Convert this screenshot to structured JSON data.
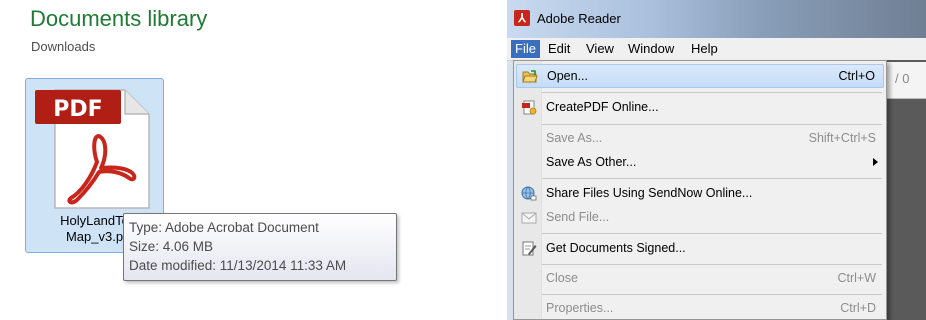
{
  "library": {
    "title": "Documents library",
    "subtitle": "Downloads",
    "file": {
      "badge": "PDF",
      "name_line1": "HolyLandTo",
      "name_line2": "Map_v3.p"
    },
    "tooltip": {
      "type": "Type: Adobe Acrobat Document",
      "size": "Size: 4.06 MB",
      "date": "Date modified: 11/13/2014 11:33 AM"
    }
  },
  "reader": {
    "title": "Adobe Reader",
    "app_icon_glyph": "⅄",
    "menubar": [
      "File",
      "Edit",
      "View",
      "Window",
      "Help"
    ],
    "page_indicator": "/ 0",
    "file_menu": [
      {
        "label": "Open...",
        "shortcut": "Ctrl+O",
        "icon": "open-folder-icon",
        "state": "highlighted"
      },
      {
        "label": "CreatePDF Online...",
        "shortcut": "",
        "icon": "createpdf-icon",
        "state": "enabled"
      },
      {
        "label": "Save As...",
        "shortcut": "Shift+Ctrl+S",
        "icon": "",
        "state": "disabled"
      },
      {
        "label": "Save As Other...",
        "shortcut": "",
        "icon": "",
        "state": "enabled",
        "submenu": true
      },
      {
        "label": "Share Files Using SendNow Online...",
        "shortcut": "",
        "icon": "share-globe-icon",
        "state": "enabled"
      },
      {
        "label": "Send File...",
        "shortcut": "",
        "icon": "envelope-icon",
        "state": "disabled"
      },
      {
        "label": "Get Documents Signed...",
        "shortcut": "",
        "icon": "sign-document-icon",
        "state": "enabled"
      },
      {
        "label": "Close",
        "shortcut": "Ctrl+W",
        "icon": "",
        "state": "disabled"
      },
      {
        "label": "Properties...",
        "shortcut": "Ctrl+D",
        "icon": "",
        "state": "disabled"
      }
    ]
  },
  "colors": {
    "library_title": "#1e7b34",
    "selection": "#cfe3f7",
    "pdf_red": "#c8261c",
    "menu_active": "#3a6fc0"
  }
}
